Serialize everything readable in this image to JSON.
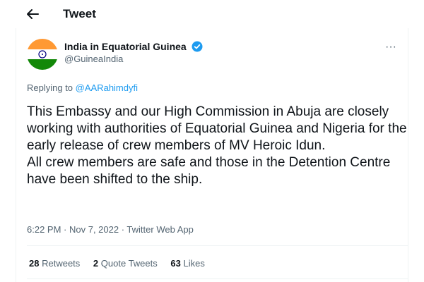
{
  "header": {
    "title": "Tweet",
    "back_icon": "arrow-left-icon"
  },
  "author": {
    "display_name": "India in Equatorial Guinea",
    "handle": "@GuineaIndia",
    "verified_icon": "verified-badge-icon",
    "avatar": "india-flag-avatar",
    "more_label": "···"
  },
  "reply": {
    "prefix": "Replying to ",
    "to": "@AARahimdyfi"
  },
  "tweet": {
    "text": "This Embassy and our High Commission in Abuja are closely working with authorities of Equatorial Guinea and Nigeria for the early release of crew members of MV Heroic Idun.\nAll crew members are safe and those in the Detention Centre have been shifted to the ship."
  },
  "meta": {
    "time": "6:22 PM",
    "sep1": " · ",
    "date": "Nov 7, 2022",
    "sep2": " · ",
    "source": "Twitter Web App"
  },
  "stats": {
    "retweets_count": "28",
    "retweets_label": "Retweets",
    "quotes_count": "2",
    "quotes_label": "Quote Tweets",
    "likes_count": "63",
    "likes_label": "Likes"
  },
  "colors": {
    "accent": "#1d9bf0",
    "text": "#0f1419",
    "secondary": "#536471",
    "divider": "#eff3f4"
  }
}
